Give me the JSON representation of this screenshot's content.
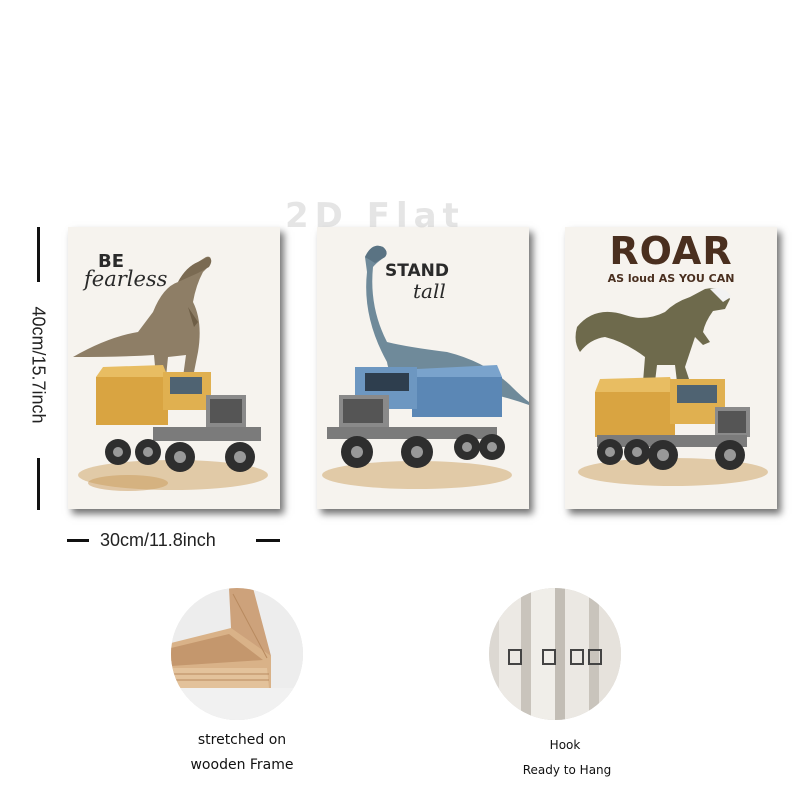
{
  "watermark": "2D Flat",
  "panels": [
    {
      "line1": "BE",
      "line2": "fearless"
    },
    {
      "line1": "STAND",
      "line2": "tall"
    },
    {
      "line1": "ROAR",
      "line2": "AS loud AS YOU CAN"
    }
  ],
  "dimensions": {
    "height_label": "40cm/15.7inch",
    "width_label": "30cm/11.8inch"
  },
  "features": [
    {
      "caption_line1": "stretched on",
      "caption_line2": "wooden Frame"
    },
    {
      "caption_line1": "Hook",
      "caption_line2": "Ready to Hang"
    }
  ],
  "colors": {
    "roar_text": "#4a2f1f",
    "truck_yellow": "#d9a441",
    "truck_blue": "#5b87b5",
    "dino_brown": "#8e7e66",
    "dino_blue_gray": "#6f8a9a",
    "dino_green": "#6e6a4c"
  }
}
